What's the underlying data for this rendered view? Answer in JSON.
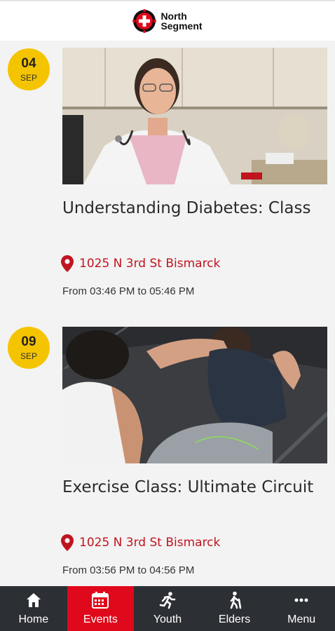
{
  "brand": {
    "line1": "North",
    "line2": "Segment"
  },
  "events": [
    {
      "day": "04",
      "month": "SEP",
      "title": "Understanding Diabetes: Class",
      "location": "1025 N 3rd St Bismarck",
      "time": "From 03:46 PM to 05:46 PM",
      "image_subject": "doctor-photo"
    },
    {
      "day": "09",
      "month": "SEP",
      "title": "Exercise Class: Ultimate Circuit",
      "location": "1025 N 3rd St Bismarck",
      "time": "From 03:56 PM to 04:56 PM",
      "image_subject": "exercise-photo"
    }
  ],
  "tabs": [
    {
      "label": "Home",
      "icon": "home-icon",
      "active": false
    },
    {
      "label": "Events",
      "icon": "calendar-icon",
      "active": true
    },
    {
      "label": "Youth",
      "icon": "runner-icon",
      "active": false
    },
    {
      "label": "Elders",
      "icon": "walker-icon",
      "active": false
    },
    {
      "label": "Menu",
      "icon": "more-icon",
      "active": false
    }
  ],
  "colors": {
    "accent": "#e0081b",
    "badge": "#f5c400",
    "tabbar": "#2c2f33",
    "location": "#c0141f"
  }
}
